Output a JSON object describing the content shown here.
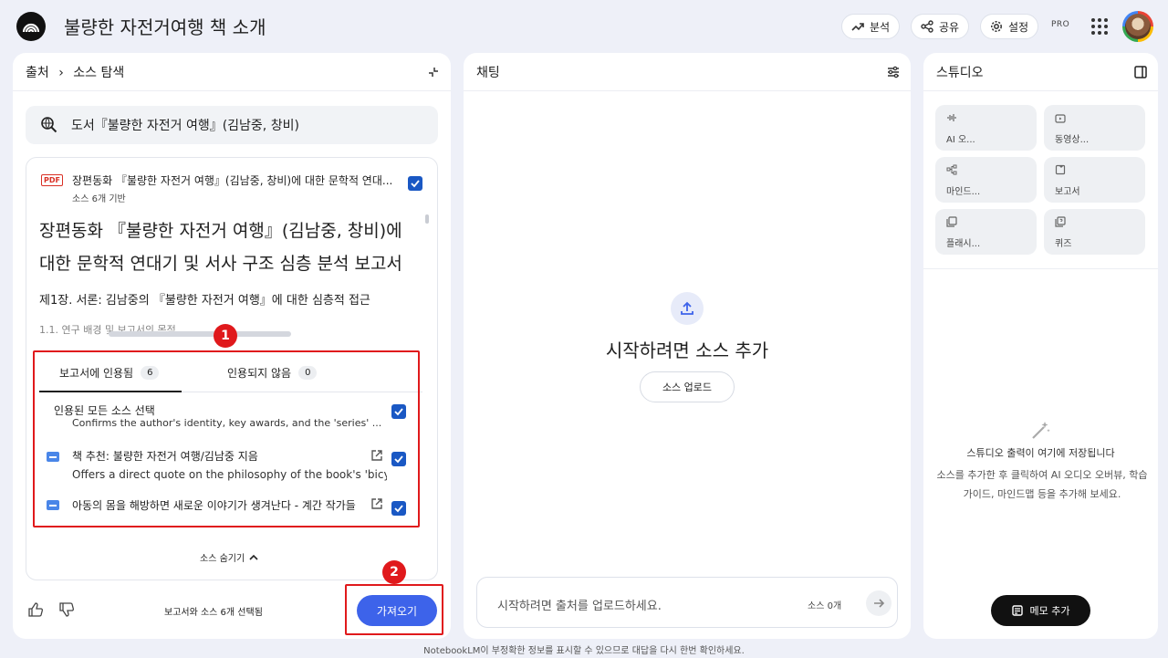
{
  "header": {
    "title": "불량한 자전거여행 책 소개",
    "buttons": {
      "analyze": "분석",
      "share": "공유",
      "settings": "설정"
    },
    "pro_badge": "PRO"
  },
  "source_panel": {
    "breadcrumb_root": "출처",
    "breadcrumb_current": "소스 탐색",
    "search_query": "도서『불량한 자전거 여행』(김남중, 창비)",
    "document": {
      "type_badge": "PDF",
      "title": "장편동화 『불량한 자전거 여행』(김남중, 창비)에 대한 문학적 연대...",
      "subtitle": "소스 6개 기반",
      "heading": "장편동화 『불량한 자전거 여행』(김남중, 창비)에 대한 문학적 연대기 및 서사 구조 심층 분석 보고서",
      "chapter": "제1장. 서론: 김남중의 『불량한 자전거 여행』에 대한 심층적 접근",
      "faded_line": "1.1. 연구 배경 및 보고서의 목적"
    },
    "tabs": [
      {
        "label": "보고서에 인용됨",
        "count": "6"
      },
      {
        "label": "인용되지 않음",
        "count": "0"
      }
    ],
    "select_all": "인용된 모든 소스 선택",
    "cut_line": "Confirms the author's identity, key awards, and the 'series' ...",
    "items": [
      {
        "title": "책 추천: 불량한 자전거 여행/김남중 지음",
        "desc": "Offers a direct quote on the philosophy of the book's 'bicy..."
      },
      {
        "title": "아동의 몸을 해방하면 새로운 이야기가 생겨난다 - 계간 작가들",
        "desc": ""
      }
    ],
    "hide_sources": "소스 숨기기",
    "selected_text": "보고서와 소스 6개 선택됨",
    "import_button": "가져오기"
  },
  "annotations": {
    "marker1": "1",
    "marker2": "2"
  },
  "chat_panel": {
    "title": "채팅",
    "heading": "시작하려면 소스 추가",
    "upload_button": "소스 업로드",
    "input_placeholder": "시작하려면 출처를 업로드하세요.",
    "source_count": "소스 0개"
  },
  "studio_panel": {
    "title": "스튜디오",
    "tiles": [
      {
        "label": "AI 오...",
        "icon": "audio-icon"
      },
      {
        "label": "동영상...",
        "icon": "video-icon"
      },
      {
        "label": "마인드...",
        "icon": "mindmap-icon"
      },
      {
        "label": "보고서",
        "icon": "report-icon"
      },
      {
        "label": "플래시...",
        "icon": "flashcard-icon"
      },
      {
        "label": "퀴즈",
        "icon": "quiz-icon"
      }
    ],
    "empty_title": "스튜디오 출력이 여기에 저장됩니다",
    "empty_desc": "소스를 추가한 후 클릭하여 AI 오디오 오버뷰, 학습 가이드, 마인드맵 등을 추가해 보세요.",
    "memo_button": "메모 추가"
  },
  "footer": {
    "disclaimer": "NotebookLM이 부정확한 정보를 표시할 수 있으므로 대답을 다시 한번 확인하세요."
  },
  "colors": {
    "accent": "#3d63ea",
    "checkbox": "#1a58c4",
    "annotation_red": "#e0191c"
  }
}
